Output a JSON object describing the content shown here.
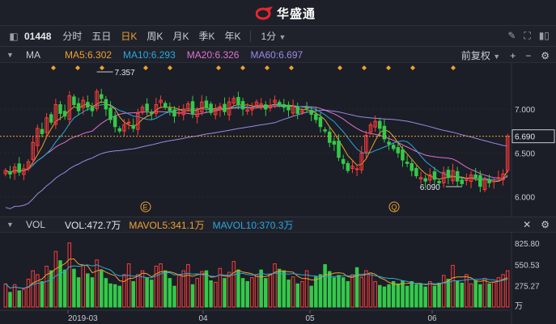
{
  "brand": {
    "name": "华盛通"
  },
  "toolbar": {
    "stock_code": "01448",
    "tabs": [
      "分时",
      "五日",
      "日K",
      "周K",
      "月K",
      "季K",
      "年K"
    ],
    "active_tab": "日K",
    "interval": "1分",
    "icons": [
      "pen-icon",
      "fullscreen-icon",
      "layout-icon"
    ]
  },
  "ma_bar": {
    "label": "MA",
    "items": [
      {
        "text": "MA5:6.302",
        "color": "#f0a030"
      },
      {
        "text": "MA10:6.293",
        "color": "#2aa8e0"
      },
      {
        "text": "MA20:6.326",
        "color": "#e070d0"
      },
      {
        "text": "MA60:6.697",
        "color": "#9a8ae8"
      }
    ],
    "adjust": "前复权"
  },
  "price_axis": {
    "ticks": [
      "7.000",
      "6.500",
      "6.000"
    ],
    "current": "6.690"
  },
  "annotations": {
    "high": "7.357",
    "low": "6.090",
    "marker_e": "E",
    "marker_q": "Q"
  },
  "vol_bar": {
    "label": "VOL",
    "items": [
      {
        "text": "VOL:472.7万",
        "color": "#e6e8ec"
      },
      {
        "text": "MAVOL5:341.1万",
        "color": "#f0a030"
      },
      {
        "text": "MAVOL10:370.3万",
        "color": "#2aa8e0"
      }
    ]
  },
  "vol_axis": {
    "ticks": [
      "825.80",
      "550.53",
      "275.27"
    ],
    "unit": "万"
  },
  "time_axis": {
    "labels": [
      "2019-03",
      "04",
      "05",
      "06"
    ]
  },
  "colors": {
    "up": "#ff3b3b",
    "down": "#35c94a",
    "accent": "#f0a030"
  },
  "chart_data": {
    "type": "candlestick",
    "price_range": [
      5.85,
      7.45
    ],
    "volume_range": [
      0,
      900
    ],
    "volume_unit": "万",
    "series": [
      "MA5",
      "MA10",
      "MA20",
      "MA60"
    ],
    "closes": [
      6.3,
      6.26,
      6.34,
      6.28,
      6.32,
      6.4,
      6.62,
      6.78,
      6.72,
      6.9,
      6.85,
      7.05,
      6.95,
      6.92,
      7.15,
      7.05,
      6.98,
      7.1,
      7.02,
      6.98,
      7.2,
      7.12,
      7.0,
      6.88,
      6.8,
      6.75,
      6.82,
      6.85,
      6.78,
      6.95,
      7.02,
      6.98,
      6.95,
      7.05,
      7.1,
      7.02,
      6.98,
      6.92,
      6.96,
      7.0,
      7.06,
      6.95,
      6.98,
      7.08,
      7.02,
      6.96,
      6.99,
      7.03,
      6.97,
      7.08,
      7.12,
      7.05,
      7.0,
      6.99,
      7.02,
      7.08,
      7.06,
      7.0,
      7.04,
      7.1,
      7.05,
      7.02,
      6.99,
      7.03,
      6.95,
      6.98,
      7.01,
      6.94,
      6.88,
      6.8,
      6.75,
      6.62,
      6.6,
      6.45,
      6.38,
      6.3,
      6.35,
      6.32,
      6.5,
      6.7,
      6.82,
      6.86,
      6.78,
      6.66,
      6.6,
      6.55,
      6.5,
      6.42,
      6.38,
      6.3,
      6.24,
      6.22,
      6.18,
      6.25,
      6.2,
      6.16,
      6.28,
      6.22,
      6.3,
      6.18,
      6.15,
      6.2,
      6.25,
      6.22,
      6.12,
      6.2,
      6.16,
      6.18,
      6.22,
      6.26,
      6.69
    ],
    "volumes": [
      300,
      190,
      290,
      210,
      230,
      360,
      470,
      420,
      330,
      530,
      470,
      720,
      600,
      480,
      830,
      490,
      380,
      540,
      430,
      380,
      610,
      470,
      370,
      300,
      290,
      270,
      420,
      560,
      330,
      420,
      470,
      380,
      350,
      530,
      560,
      470,
      370,
      270,
      410,
      470,
      550,
      290,
      370,
      460,
      470,
      340,
      320,
      500,
      370,
      450,
      590,
      480,
      370,
      330,
      380,
      420,
      480,
      370,
      420,
      560,
      490,
      470,
      350,
      390,
      300,
      330,
      470,
      270,
      390,
      420,
      550,
      460,
      380,
      410,
      380,
      330,
      420,
      510,
      380,
      470,
      440,
      330,
      280,
      260,
      290,
      330,
      300,
      340,
      270,
      330,
      290,
      300,
      260,
      330,
      270,
      310,
      410,
      360,
      540,
      330,
      310,
      420,
      300,
      340,
      290,
      370,
      300,
      320,
      380,
      420,
      470
    ]
  }
}
